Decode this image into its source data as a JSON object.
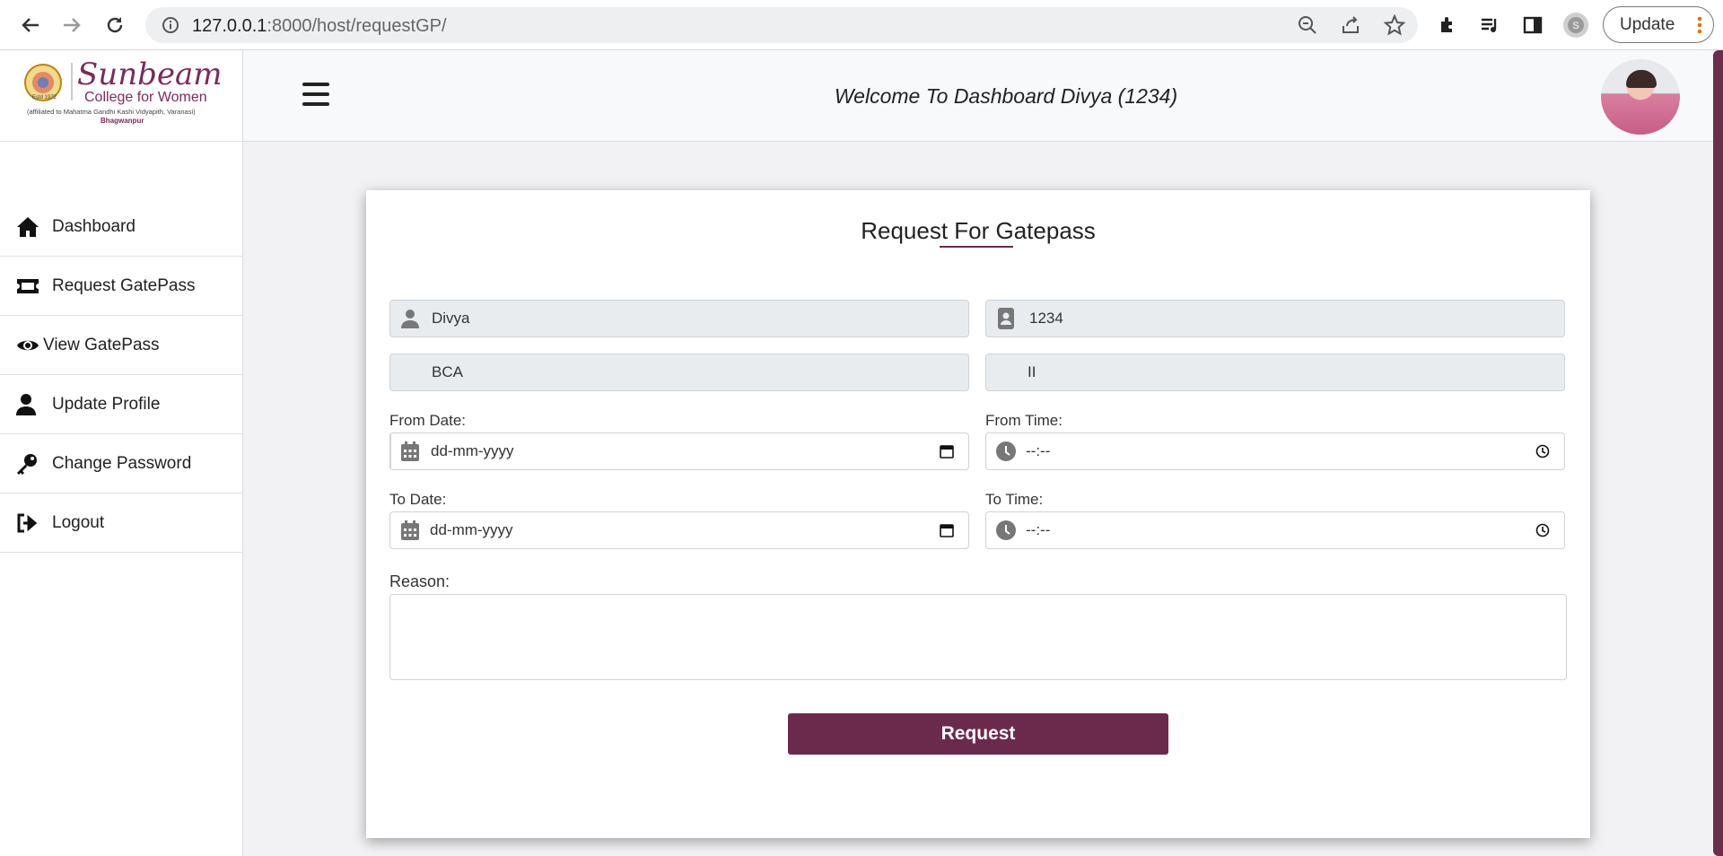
{
  "browser": {
    "url_host": "127.0.0.1",
    "url_path": ":8000/host/requestGP/",
    "update_label": "Update"
  },
  "sidebar": {
    "logo": {
      "name": "Sunbeam",
      "subtitle": "College for Women",
      "affiliation": "(affiliated to Mahatma Gandhi Kashi Vidyapith, Varanasi)",
      "location": "Bhagwanpur",
      "estd": "Estd 1972"
    },
    "items": [
      {
        "label": "Dashboard",
        "icon": "home-icon"
      },
      {
        "label": "Request GatePass",
        "icon": "ticket-icon"
      },
      {
        "label": "View GatePass",
        "icon": "eye-icon"
      },
      {
        "label": "Update Profile",
        "icon": "user-icon"
      },
      {
        "label": "Change Password",
        "icon": "key-icon"
      },
      {
        "label": "Logout",
        "icon": "logout-icon"
      }
    ]
  },
  "header": {
    "welcome": "Welcome To Dashboard Divya (1234)"
  },
  "form": {
    "title": "Request For Gatepass",
    "name_value": "Divya",
    "id_value": "1234",
    "course_value": "BCA",
    "year_value": "II",
    "from_date_label": "From Date:",
    "from_date_placeholder": "dd-mm-yyyy",
    "from_time_label": "From Time:",
    "from_time_placeholder": "--:--",
    "to_date_label": "To Date:",
    "to_date_placeholder": "dd-mm-yyyy",
    "to_time_label": "To Time:",
    "to_time_placeholder": "--:--",
    "reason_label": "Reason:",
    "reason_value": "",
    "submit_label": "Request"
  },
  "colors": {
    "brand": "#6b2a4c",
    "field_bg": "#e9ecef"
  }
}
